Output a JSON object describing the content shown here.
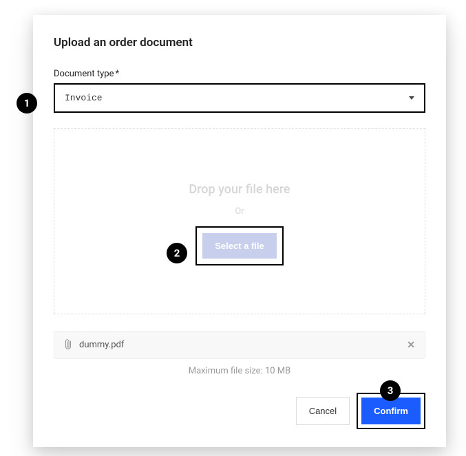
{
  "modal": {
    "title": "Upload an order document",
    "document_type_label": "Document type",
    "required_mark": "*",
    "document_type_value": "Invoice",
    "dropzone": {
      "drop_text": "Drop your file here",
      "or_text": "Or",
      "select_button": "Select a file"
    },
    "attached_file": {
      "name": "dummy.pdf"
    },
    "max_size_text": "Maximum file size: 10 MB",
    "buttons": {
      "cancel": "Cancel",
      "confirm": "Confirm"
    }
  },
  "callouts": {
    "one": "1",
    "two": "2",
    "three": "3"
  }
}
